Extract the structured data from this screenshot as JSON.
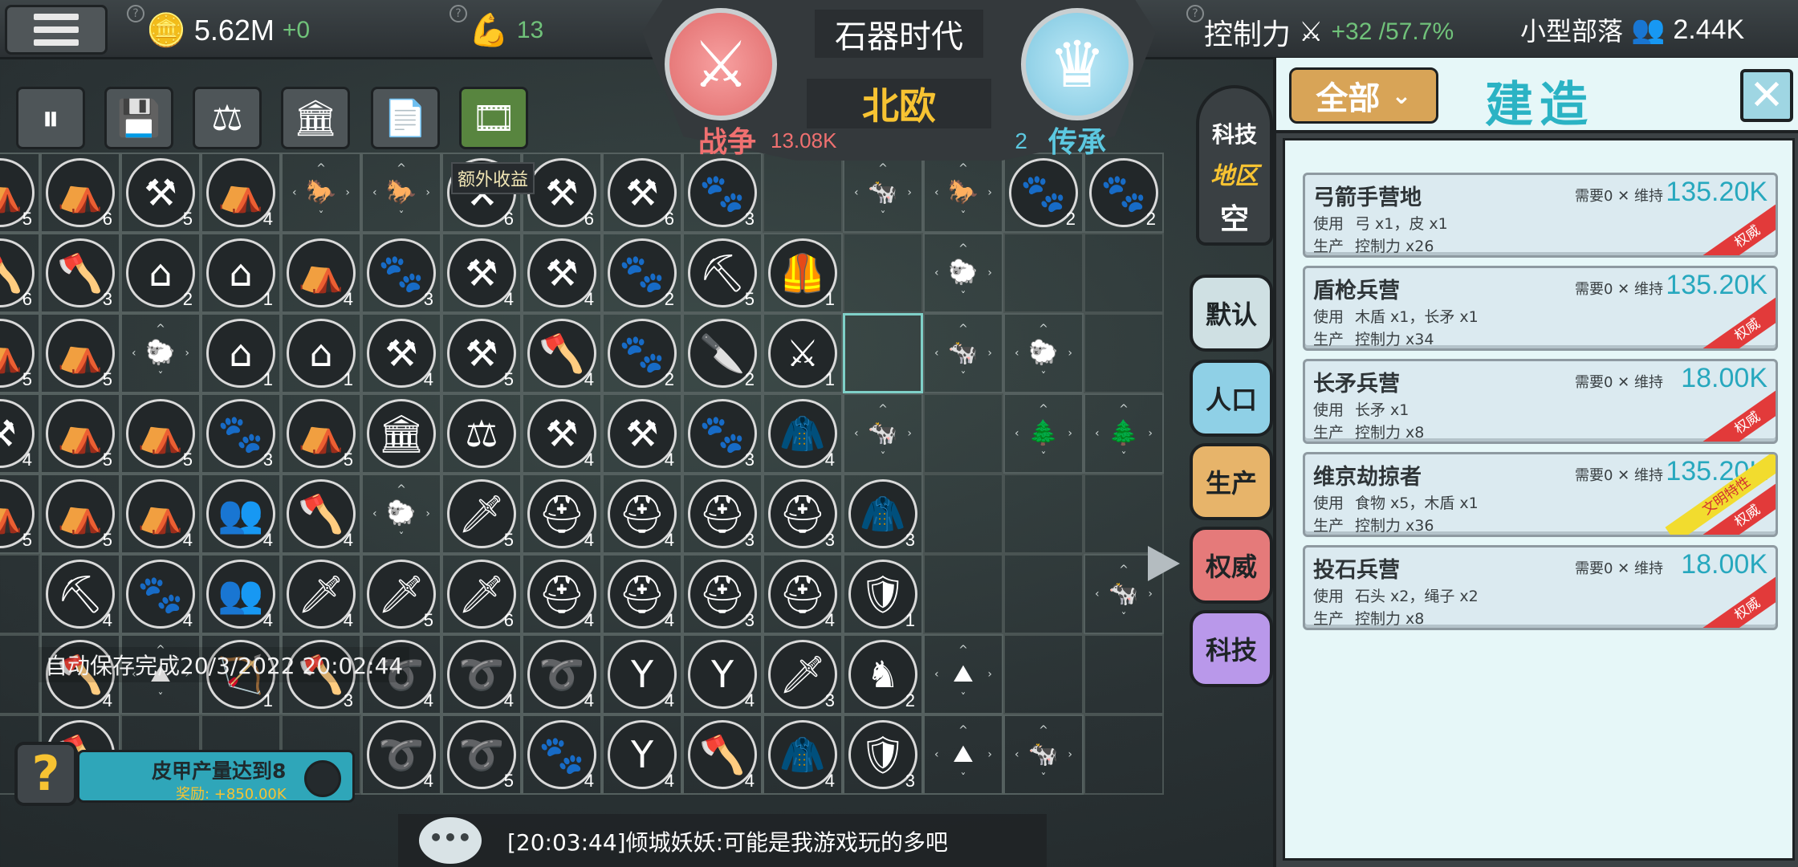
{
  "top_bar": {
    "money": "5.62M",
    "money_delta": "+0",
    "strength": "13",
    "control_label": "控制力",
    "control_value": "+32 /57.7%",
    "tribe_label": "小型部落",
    "population": "2.44K"
  },
  "era": {
    "title": "石器时代",
    "region": "北欧",
    "war_label": "战争",
    "war_value": "13.08K",
    "legacy_label": "传承",
    "legacy_value": "2"
  },
  "toolbar": {
    "bonus_label": "额外收益"
  },
  "side_tabs": {
    "tech_top": "科技",
    "region": "地区",
    "empty": "空",
    "default": "默认",
    "population": "人口",
    "production": "生产",
    "authority": "权威",
    "tech": "科技"
  },
  "panel": {
    "filter": "全部",
    "title": "建造",
    "close": "✕",
    "items": [
      {
        "name": "弓箭手营地",
        "req": "需要0 ✕ 维持",
        "cost": "135.20K",
        "use_label": "使用",
        "use": "弓 x1，皮 x1",
        "prod_label": "生产",
        "prod": "控制力 x26",
        "ribbon": "权威",
        "special": ""
      },
      {
        "name": "盾枪兵营",
        "req": "需要0 ✕ 维持",
        "cost": "135.20K",
        "use_label": "使用",
        "use": "木盾 x1，长矛 x1",
        "prod_label": "生产",
        "prod": "控制力 x34",
        "ribbon": "权威",
        "special": ""
      },
      {
        "name": "长矛兵营",
        "req": "需要0 ✕ 维持",
        "cost": "18.00K",
        "use_label": "使用",
        "use": "长矛 x1",
        "prod_label": "生产",
        "prod": "控制力 x8",
        "ribbon": "权威",
        "special": ""
      },
      {
        "name": "维京劫掠者",
        "req": "需要0 ✕ 维持",
        "cost": "135.20K",
        "use_label": "使用",
        "use": "食物 x5，木盾 x1",
        "prod_label": "生产",
        "prod": "控制力 x36",
        "ribbon": "权威",
        "special": "文明特性"
      },
      {
        "name": "投石兵营",
        "req": "需要0 ✕ 维持",
        "cost": "18.00K",
        "use_label": "使用",
        "use": "石头 x2，绳子 x2",
        "prod_label": "生产",
        "prod": "控制力 x8",
        "ribbon": "权威",
        "special": ""
      }
    ]
  },
  "autosave": "自动保存完成20/3/2022 20:02:44",
  "quest": {
    "title": "皮甲产量达到8",
    "reward": "奖励: +850.00K"
  },
  "chat": {
    "message": "[20:03:44]倾城妖妖:可能是我游戏玩的多吧"
  },
  "colors": {
    "accent_teal": "#2bb3c4",
    "gold": "#f7c332",
    "war_red": "#f07070",
    "money_green": "#70c27a"
  },
  "grid": {
    "rows": [
      [
        [
          "tent",
          "5"
        ],
        [
          "tent",
          "6"
        ],
        [
          "scythe",
          "5"
        ],
        [
          "tent",
          "4"
        ],
        [
          "horse",
          ""
        ],
        [
          "horse",
          ""
        ],
        [
          "scythe",
          "6"
        ],
        [
          "scythe",
          "6"
        ],
        [
          "scythe",
          "6"
        ],
        [
          "paw",
          "3"
        ],
        [
          "",
          ""
        ],
        [
          "cow",
          ""
        ],
        [
          "horse",
          ""
        ],
        [
          "paw",
          "2"
        ],
        [
          "paw",
          "2"
        ]
      ],
      [
        [
          "axe",
          "6"
        ],
        [
          "axe",
          "3"
        ],
        [
          "house",
          "2"
        ],
        [
          "house",
          "1"
        ],
        [
          "tent",
          "4"
        ],
        [
          "paw",
          "3"
        ],
        [
          "scythe",
          "4"
        ],
        [
          "scythe",
          "4"
        ],
        [
          "paw",
          "2"
        ],
        [
          "pick",
          "5"
        ],
        [
          "armor",
          "1"
        ],
        [
          "",
          ""
        ],
        [
          "sheep",
          ""
        ],
        [
          "",
          ""
        ],
        [
          "",
          ""
        ]
      ],
      [
        [
          "tent",
          "5"
        ],
        [
          "tent",
          "5"
        ],
        [
          "sheep",
          ""
        ],
        [
          "house",
          "1"
        ],
        [
          "house",
          "1"
        ],
        [
          "scythe",
          "4"
        ],
        [
          "scythe",
          "5"
        ],
        [
          "axe",
          "4"
        ],
        [
          "paw",
          "2"
        ],
        [
          "cleaver",
          "2"
        ],
        [
          "axes",
          "1"
        ],
        [
          "sel",
          ""
        ],
        [
          "cow",
          ""
        ],
        [
          "sheep",
          ""
        ],
        [
          "",
          ""
        ]
      ],
      [
        [
          "scythe",
          "4"
        ],
        [
          "tent",
          "5"
        ],
        [
          "tent",
          "5"
        ],
        [
          "paw",
          "3"
        ],
        [
          "tent",
          "5"
        ],
        [
          "hall",
          ""
        ],
        [
          "scale",
          ""
        ],
        [
          "scythe",
          "4"
        ],
        [
          "scythe",
          "4"
        ],
        [
          "paw",
          "3"
        ],
        [
          "cloth",
          "4"
        ],
        [
          "cow",
          ""
        ],
        [
          "",
          ""
        ],
        [
          "tree",
          ""
        ],
        [
          "tree",
          ""
        ]
      ],
      [
        [
          "tent",
          "5"
        ],
        [
          "tent",
          "5"
        ],
        [
          "tent",
          "4"
        ],
        [
          "meeting",
          "4"
        ],
        [
          "axe",
          "4"
        ],
        [
          "sheep",
          ""
        ],
        [
          "spear",
          "5"
        ],
        [
          "helmet",
          "4"
        ],
        [
          "helmet",
          "4"
        ],
        [
          "helmet",
          "3"
        ],
        [
          "helmet",
          "3"
        ],
        [
          "cloth",
          "3"
        ],
        [
          "",
          ""
        ],
        [
          "",
          ""
        ],
        [
          "",
          ""
        ]
      ],
      [
        [
          "",
          ""
        ],
        [
          "pick",
          "4"
        ],
        [
          "paw",
          "4"
        ],
        [
          "meeting",
          "4"
        ],
        [
          "spear",
          "4"
        ],
        [
          "spear",
          "5"
        ],
        [
          "spear",
          "6"
        ],
        [
          "helmet",
          "4"
        ],
        [
          "helmet",
          "4"
        ],
        [
          "helmet",
          "3"
        ],
        [
          "helmet",
          "4"
        ],
        [
          "shield",
          "1"
        ],
        [
          "",
          ""
        ],
        [
          "",
          ""
        ],
        [
          "cow",
          ""
        ]
      ],
      [
        [
          "",
          ""
        ],
        [
          "axe",
          "4"
        ],
        [
          "mountain",
          ""
        ],
        [
          "bow",
          "1"
        ],
        [
          "axe",
          "3"
        ],
        [
          "rope",
          "4"
        ],
        [
          "rope",
          "4"
        ],
        [
          "rope",
          "4"
        ],
        [
          "sling",
          "4"
        ],
        [
          "sling",
          "4"
        ],
        [
          "spear",
          "3"
        ],
        [
          "knight",
          "2"
        ],
        [
          "mountain",
          ""
        ],
        [
          "",
          ""
        ],
        [
          "",
          ""
        ]
      ],
      [
        [
          "",
          ""
        ],
        [
          "axe",
          "4"
        ],
        [
          "",
          ""
        ],
        [
          "",
          ""
        ],
        [
          "",
          ""
        ],
        [
          "rope",
          "4"
        ],
        [
          "rope",
          "5"
        ],
        [
          "paw",
          "4"
        ],
        [
          "sling",
          "4"
        ],
        [
          "axe",
          "4"
        ],
        [
          "cloth",
          "4"
        ],
        [
          "shield",
          "3"
        ],
        [
          "mountain",
          ""
        ],
        [
          "cow",
          ""
        ],
        [
          "",
          ""
        ]
      ]
    ]
  }
}
